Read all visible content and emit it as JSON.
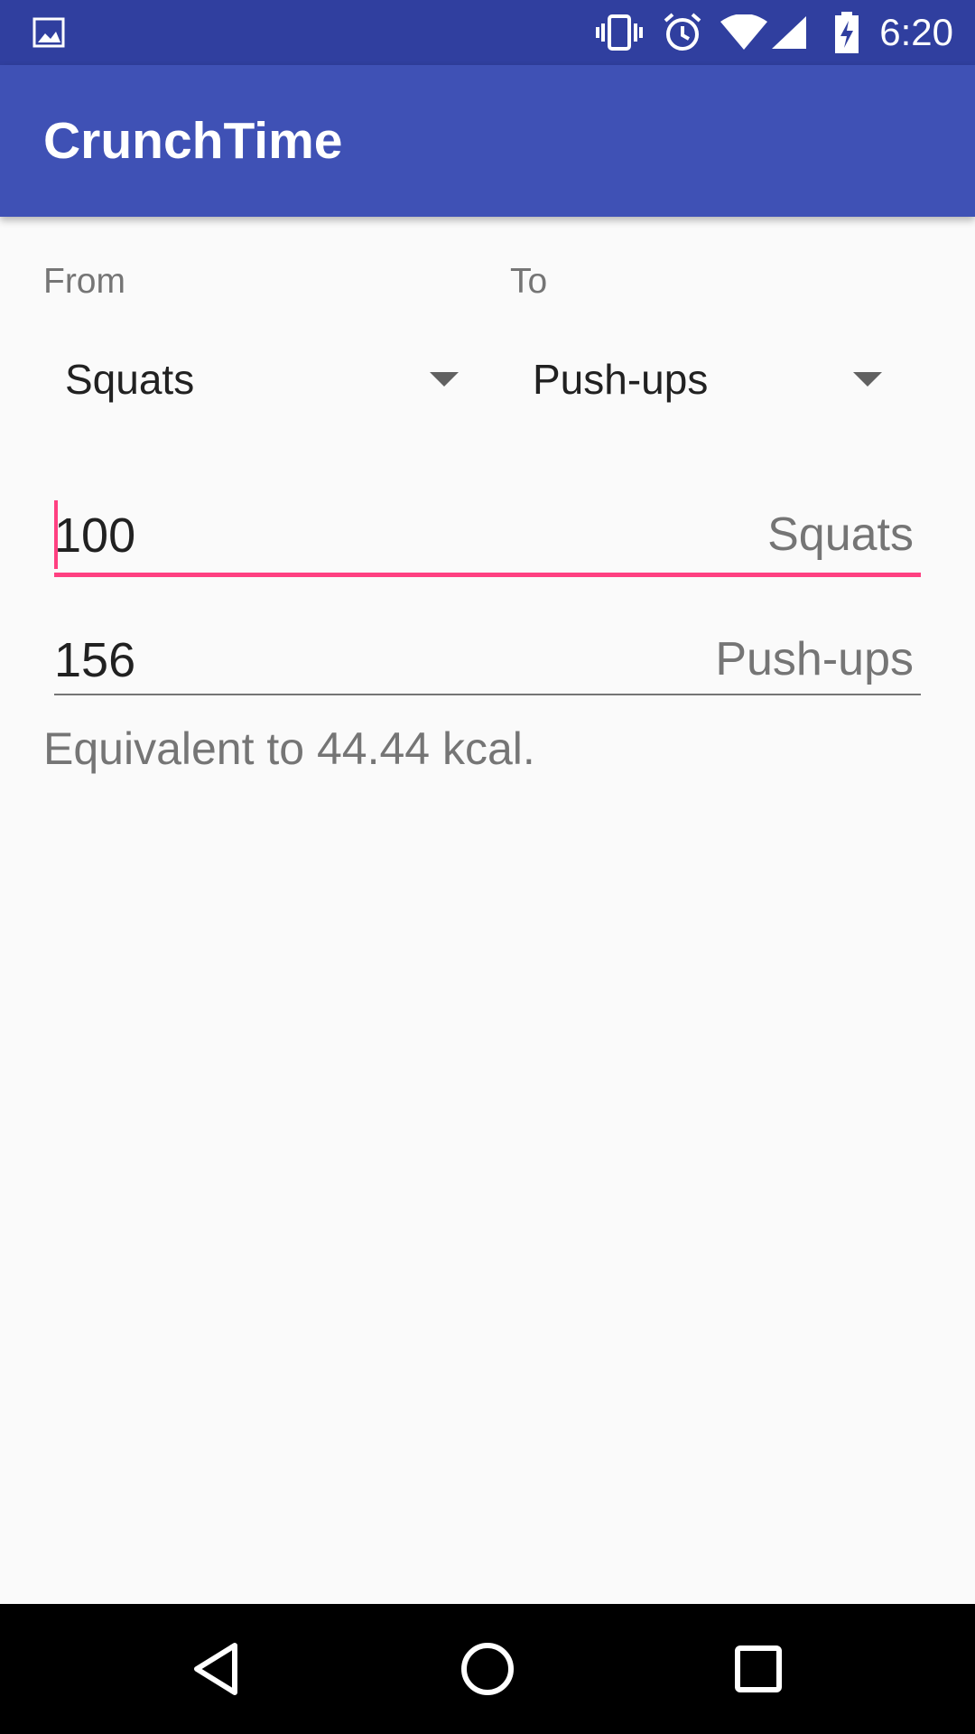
{
  "status_bar": {
    "time": "6:20",
    "icons": [
      "image-notification-icon",
      "vibrate-icon",
      "alarm-icon",
      "wifi-icon",
      "cellular-signal-icon",
      "battery-charging-icon"
    ]
  },
  "app_bar": {
    "title": "CrunchTime"
  },
  "converter": {
    "from_label": "From",
    "to_label": "To",
    "from_selected": "Squats",
    "to_selected": "Push-ups",
    "from_value": "100",
    "from_unit": "Squats",
    "to_value": "156",
    "to_unit": "Push-ups",
    "equivalent_text": "Equivalent to 44.44 kcal."
  },
  "nav_bar": {
    "buttons": [
      "back-icon",
      "home-icon",
      "recents-icon"
    ]
  },
  "colors": {
    "status_bar": "#303f9f",
    "primary": "#3f51b5",
    "accent": "#ff4081",
    "background": "#fafafa"
  }
}
